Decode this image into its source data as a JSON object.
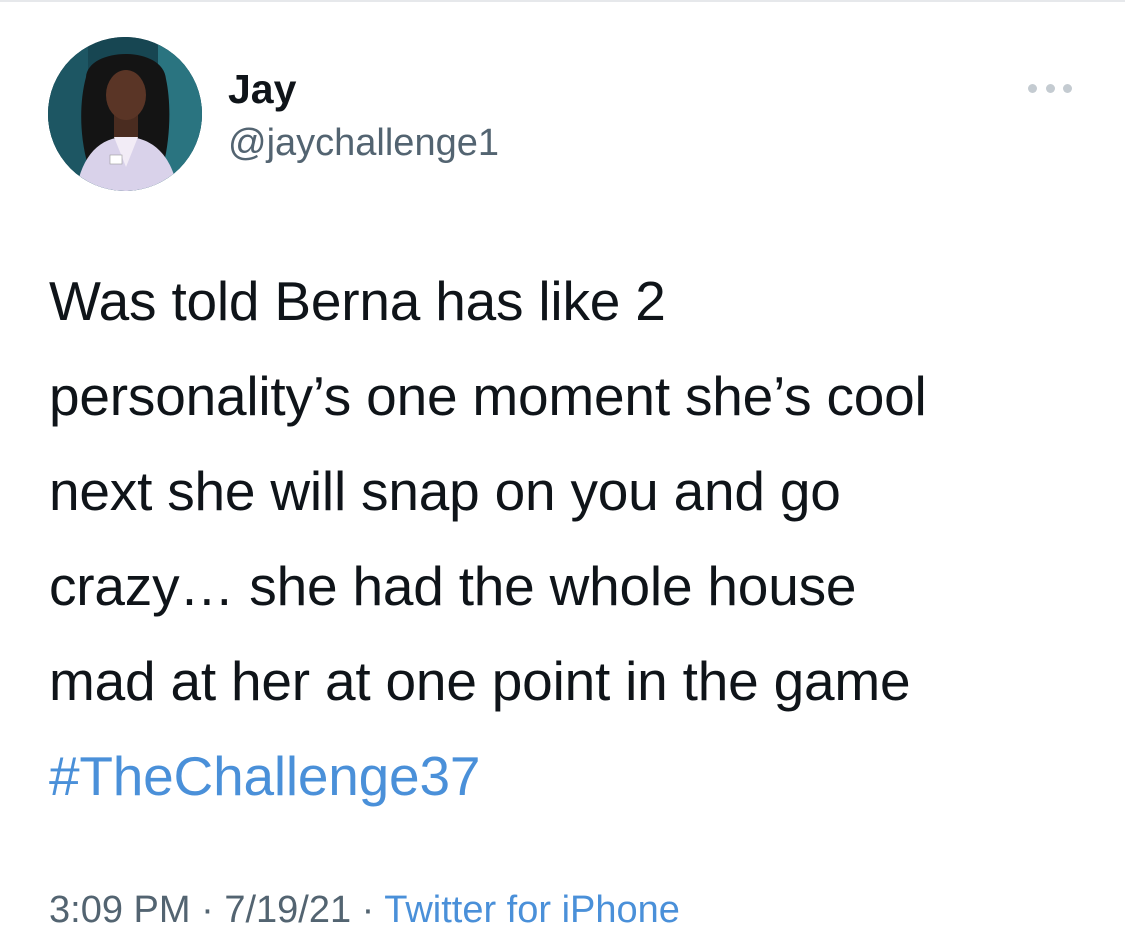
{
  "author": {
    "display_name": "Jay",
    "handle": "@jaychallenge1"
  },
  "tweet": {
    "lines": [
      "Was told Berna has like 2",
      "personality’s one moment she’s cool",
      "next she will snap on you and go",
      "crazy… she had the whole house",
      "mad at her at one point in the game"
    ],
    "hashtag": "#TheChallenge37"
  },
  "meta": {
    "time": "3:09 PM",
    "separator": "·",
    "date": "7/19/21",
    "source": "Twitter for iPhone"
  },
  "colors": {
    "text": "#0f1419",
    "secondary": "#536471",
    "link": "#4a90d9"
  },
  "icons": {
    "more": "more-horizontal-icon"
  }
}
